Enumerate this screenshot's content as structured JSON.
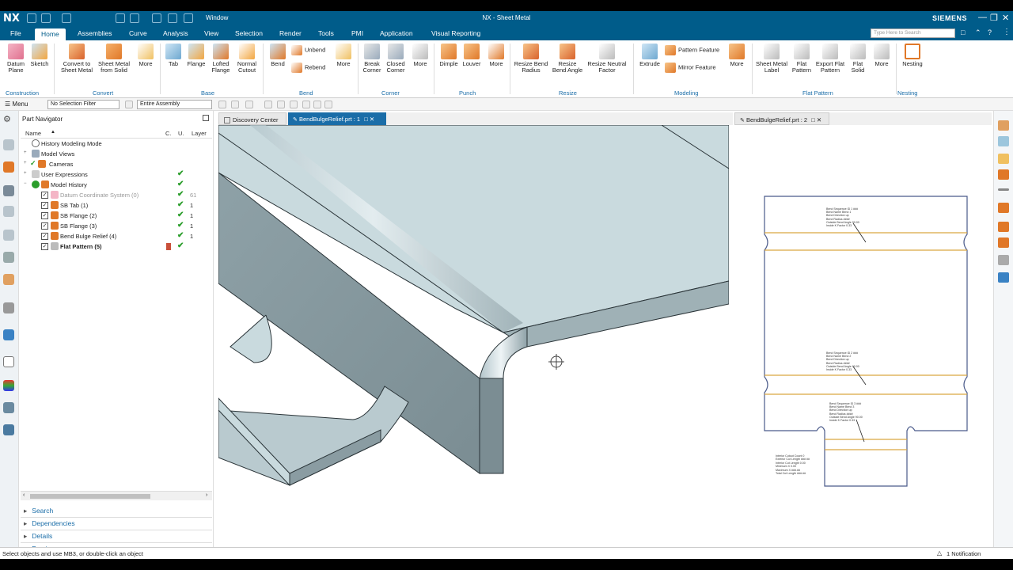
{
  "app": {
    "logo": "NX",
    "title": "NX - Sheet Metal",
    "brand": "SIEMENS",
    "window_label": "Window"
  },
  "menu": {
    "tabs": [
      "File",
      "Home",
      "Assemblies",
      "Curve",
      "Analysis",
      "View",
      "Selection",
      "Render",
      "Tools",
      "PMI",
      "Application",
      "Visual Reporting"
    ],
    "active": "Home",
    "search_placeholder": "Type Here to Search"
  },
  "ribbon": {
    "datum_plane": "Datum Plane",
    "sketch": "Sketch",
    "convert_to_sheet_metal": "Convert to Sheet Metal",
    "sheet_metal_from_solid": "Sheet Metal from Solid",
    "more": "More",
    "tab": "Tab",
    "flange": "Flange",
    "lofted_flange": "Lofted Flange",
    "normal_cutout": "Normal Cutout",
    "bend": "Bend",
    "unbend": "Unbend",
    "rebend": "Rebend",
    "break_corner": "Break Corner",
    "closed_corner": "Closed Corner",
    "dimple": "Dimple",
    "louver": "Louver",
    "resize_bend_radius": "Resize Bend Radius",
    "resize_bend_angle": "Resize Bend Angle",
    "resize_neutral_factor": "Resize Neutral Factor",
    "extrude": "Extrude",
    "pattern_feature": "Pattern Feature",
    "mirror_feature": "Mirror Feature",
    "sheet_metal_label": "Sheet Metal Label",
    "flat_pattern": "Flat Pattern",
    "export_flat_pattern": "Export Flat Pattern",
    "flat_solid": "Flat Solid",
    "nesting": "Nesting",
    "groups": {
      "construction": "Construction",
      "convert": "Convert",
      "base": "Base",
      "bend": "Bend",
      "corner": "Corner",
      "punch": "Punch",
      "resize": "Resize",
      "modeling": "Modeling",
      "flat_pattern": "Flat Pattern",
      "nesting": "Nesting"
    }
  },
  "selection": {
    "menu": "Menu",
    "filter": "No Selection Filter",
    "scope": "Entire Assembly"
  },
  "navigator": {
    "title": "Part Navigator",
    "columns": {
      "name": "Name",
      "c": "C.",
      "u": "U.",
      "layer": "Layer"
    },
    "rows": [
      {
        "label": "History Modeling Mode",
        "check": "",
        "layer": ""
      },
      {
        "label": "Model Views",
        "check": "",
        "layer": ""
      },
      {
        "label": "Cameras",
        "check": "",
        "layer": ""
      },
      {
        "label": "User Expressions",
        "check": "✔",
        "layer": ""
      },
      {
        "label": "Model History",
        "check": "✔",
        "layer": ""
      },
      {
        "label": "Datum Coordinate System (0)",
        "check": "✔",
        "layer": "61"
      },
      {
        "label": "SB Tab (1)",
        "check": "✔",
        "layer": "1"
      },
      {
        "label": "SB Flange (2)",
        "check": "✔",
        "layer": "1"
      },
      {
        "label": "SB Flange (3)",
        "check": "✔",
        "layer": "1"
      },
      {
        "label": "Bend Bulge Relief (4)",
        "check": "✔",
        "layer": "1"
      },
      {
        "label": "Flat Pattern (5)",
        "check": "✔",
        "layer": ""
      }
    ],
    "sections": [
      "Search",
      "Dependencies",
      "Details",
      "Preview"
    ]
  },
  "tabs": {
    "discovery": "Discovery Center",
    "part1": "BendBulgeRelief.prt : 1",
    "part2": "BendBulgeRelief.prt : 2"
  },
  "drawing_notes": {
    "bend1": [
      "Bend Sequence ID 1 ###",
      "Bend Name Bend 1",
      "Bend Direction up",
      "Bend Radius ####",
      "Outside Bend Angle 90.00",
      "Inside K Factor 0.33"
    ],
    "bend2": [
      "Bend Sequence ID 2 ###",
      "Bend Name Bend 2",
      "Bend Direction up",
      "Bend Radius ####",
      "Outside Bend Angle 90.00",
      "Inside K Factor 0.33"
    ],
    "bend3": [
      "Bend Sequence ID 3 ###",
      "Bend Name Bend 3",
      "Bend Direction up",
      "Bend Radius ####",
      "Outside Bend Angle 90.00",
      "Inside K Factor 0.33"
    ],
    "summary": [
      "Interior Cutout Count 0",
      "Exterior Cut Length ### ##",
      "Interior Cut Length 0.00",
      "Minimum X 0.00",
      "Maximum X ###.##",
      "Total Cut Length ###.##"
    ]
  },
  "status": {
    "prompt": "Select objects and use MB3, or double-click an object",
    "notification": "1 Notification"
  }
}
